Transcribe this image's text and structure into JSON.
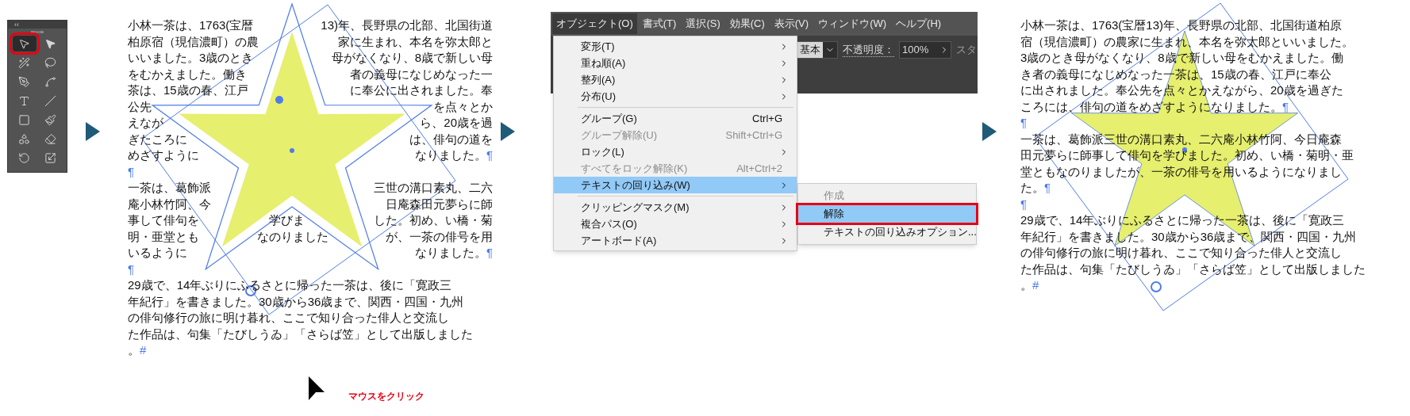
{
  "toolbar": {
    "collapse": "‹‹",
    "tools": [
      {
        "kind": "selection",
        "selected": true,
        "marked": true
      },
      {
        "kind": "direct",
        "selected": false,
        "marked": false
      },
      {
        "kind": "wand",
        "selected": false,
        "marked": false
      },
      {
        "kind": "lasso",
        "selected": false,
        "marked": false
      },
      {
        "kind": "pen",
        "selected": false,
        "marked": false
      },
      {
        "kind": "curvature",
        "selected": false,
        "marked": false
      },
      {
        "kind": "type",
        "selected": false,
        "marked": false
      },
      {
        "kind": "line",
        "selected": false,
        "marked": false
      },
      {
        "kind": "rectangle",
        "selected": false,
        "marked": false
      },
      {
        "kind": "brush",
        "selected": false,
        "marked": false
      },
      {
        "kind": "shaper",
        "selected": false,
        "marked": false
      },
      {
        "kind": "eraser",
        "selected": false,
        "marked": false
      },
      {
        "kind": "rotate",
        "selected": false,
        "marked": false
      },
      {
        "kind": "scale",
        "selected": false,
        "marked": false
      }
    ]
  },
  "before": {
    "lines": [
      {
        "segments": [
          "小林一茶は、1763(宝暦",
          "13)年、長野県の北部、北国街道"
        ]
      },
      {
        "segments": [
          "柏原宿（現信濃町）の農",
          "家に生まれ、本名を弥太郎と"
        ]
      },
      {
        "segments": [
          "いいました。3歳のとき",
          "母がなくなり、8歳で新しい母"
        ]
      },
      {
        "segments": [
          "をむかえました。働き",
          "者の義母になじめなった一"
        ]
      },
      {
        "segments": [
          "茶は、15歳の春、江戸",
          "に奉公に出されました。奉"
        ]
      },
      {
        "segments": [
          "公先",
          "を点々とか"
        ]
      },
      {
        "segments": [
          "えなが",
          "ら、20歳を過"
        ]
      },
      {
        "segments": [
          "ぎたころに",
          "は、俳句の道を"
        ]
      },
      {
        "segments": [
          "めざすように",
          "なりました。"
        ],
        "mark": "¶"
      },
      {
        "mark": "¶"
      },
      {
        "segments": [
          "一茶は、葛飾派",
          "三世の溝口素丸、二六"
        ]
      },
      {
        "segments": [
          "庵小林竹阿、今",
          "日庵森田元夢らに師"
        ]
      },
      {
        "segments": [
          "事して俳句を",
          "学びま",
          "した。初め、い橋・菊"
        ]
      },
      {
        "segments": [
          "明・亜堂とも",
          "なのりました",
          "が、一茶の俳号を用"
        ]
      },
      {
        "segments": [
          "いるように",
          "なりました。"
        ],
        "mark": "¶"
      },
      {
        "mark": "¶"
      },
      {
        "segments": [
          "29歳で、14年ぶりにふるさとに帰った一茶は、後に「寛政三"
        ]
      },
      {
        "segments": [
          "年紀行」を書きました。30歳から36歳まで、関西・四国・九州"
        ]
      },
      {
        "segments": [
          "の俳句修行の旅に明け暮れ、ここで知り合った俳人と交流し"
        ]
      },
      {
        "segments": [
          "た作品は、句集「たびしうゐ」「さらば笠」として出版しました"
        ]
      },
      {
        "segments": [
          "。"
        ],
        "mark": "#"
      }
    ]
  },
  "annotation": {
    "text": "マウスをクリック"
  },
  "app": {
    "menubar": [
      {
        "label": "オブジェクト(O)",
        "selected": true
      },
      {
        "label": "書式(T)",
        "selected": false
      },
      {
        "label": "選択(S)",
        "selected": false
      },
      {
        "label": "効果(C)",
        "selected": false
      },
      {
        "label": "表示(V)",
        "selected": false
      },
      {
        "label": "ウィンドウ(W)",
        "selected": false
      },
      {
        "label": "ヘルプ(H)",
        "selected": false
      }
    ],
    "control_bar": {
      "style": "基本",
      "opacity_label": "不透明度：",
      "opacity": "100%",
      "column_3": "スタ"
    },
    "menu": [
      {
        "kind": "item",
        "label": "変形(T)",
        "submenu": true,
        "disabled": false,
        "selected": false
      },
      {
        "kind": "item",
        "label": "重ね順(A)",
        "submenu": true,
        "disabled": false,
        "selected": false
      },
      {
        "kind": "item",
        "label": "整列(A)",
        "submenu": true,
        "disabled": false,
        "selected": false
      },
      {
        "kind": "item",
        "label": "分布(U)",
        "submenu": true,
        "disabled": false,
        "selected": false
      },
      {
        "kind": "separator"
      },
      {
        "kind": "item",
        "label": "グループ(G)",
        "shortcut": "Ctrl+G",
        "submenu": false,
        "disabled": false,
        "selected": false
      },
      {
        "kind": "item",
        "label": "グループ解除(U)",
        "shortcut": "Shift+Ctrl+G",
        "submenu": false,
        "disabled": true,
        "selected": false
      },
      {
        "kind": "item",
        "label": "ロック(L)",
        "submenu": true,
        "disabled": false,
        "selected": false
      },
      {
        "kind": "item",
        "label": "すべてをロック解除(K)",
        "shortcut": "Alt+Ctrl+2",
        "submenu": false,
        "disabled": true,
        "selected": false
      },
      {
        "kind": "item",
        "label": "テキストの回り込み(W)",
        "submenu": true,
        "disabled": false,
        "selected": true
      },
      {
        "kind": "separator"
      },
      {
        "kind": "item",
        "label": "クリッピングマスク(M)",
        "submenu": true,
        "disabled": false,
        "selected": false
      },
      {
        "kind": "item",
        "label": "複合パス(O)",
        "submenu": true,
        "disabled": false,
        "selected": false
      },
      {
        "kind": "item",
        "label": "アートボード(A)",
        "submenu": true,
        "disabled": false,
        "selected": false
      }
    ],
    "submenu": [
      {
        "label": "作成",
        "disabled": true,
        "selected": false,
        "marked": false
      },
      {
        "label": "解除",
        "disabled": false,
        "selected": true,
        "marked": true
      },
      {
        "label": "テキストの回り込みオプション...",
        "disabled": false,
        "selected": false,
        "marked": false
      }
    ]
  },
  "after": {
    "lines": [
      {
        "segments": [
          "小林一茶は、1763(宝暦13)年、長野県の北部、北国街道柏原"
        ]
      },
      {
        "segments": [
          "宿（現信濃町）の農家に生まれ、本名を弥太郎といいました。"
        ]
      },
      {
        "segments": [
          "3歳のとき母がなくなり、8歳で新しい母をむかえました。働"
        ]
      },
      {
        "segments": [
          "き者の義母になじめなった一茶は、15歳の春、江戸に奉公"
        ]
      },
      {
        "segments": [
          "に出されました。奉公先を点々とかえながら、20歳を過ぎた"
        ]
      },
      {
        "segments": [
          "ころには、俳句の道をめざすようになりました。"
        ],
        "mark": "¶"
      },
      {
        "mark": "¶"
      },
      {
        "segments": [
          "一茶は、葛飾派三世の溝口素丸、二六庵小林竹阿、今日庵森"
        ]
      },
      {
        "segments": [
          "田元夢らに師事して俳句を学びました。初め、い橋・菊明・亜"
        ]
      },
      {
        "segments": [
          "堂ともなのりましたが、一茶の俳号を用いるようになりまし"
        ]
      },
      {
        "segments": [
          "た。"
        ],
        "mark": "¶"
      },
      {
        "mark": "¶"
      },
      {
        "segments": [
          "29歳で、14年ぶりにふるさとに帰った一茶は、後に「寛政三"
        ]
      },
      {
        "segments": [
          "年紀行」を書きました。30歳から36歳まで、関西・四国・九州"
        ]
      },
      {
        "segments": [
          "の俳句修行の旅に明け暮れ、ここで知り合った俳人と交流し"
        ]
      },
      {
        "segments": [
          "た作品は、句集「たびしうゐ」「さらば笠」として出版しました"
        ]
      },
      {
        "segments": [
          "。"
        ],
        "mark": "#"
      }
    ]
  }
}
